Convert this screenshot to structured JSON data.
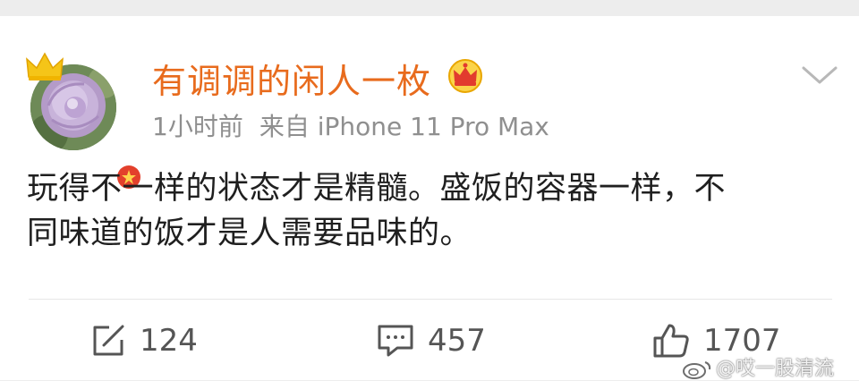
{
  "post": {
    "username": "有调调的闲人一枚",
    "time": "1小时前",
    "source": "来自 iPhone 11 Pro Max",
    "content_line1": "玩得不一样的状态才是精髓。盛饭的容器一样，不",
    "content_line2": "同味道的饭才是人需要品味的。"
  },
  "actions": {
    "repost_count": "124",
    "comment_count": "457",
    "like_count": "1707"
  },
  "watermark": {
    "text": "@哎一股清流"
  },
  "colors": {
    "username": "#e86b1d",
    "meta": "#8f8f8f",
    "body_text": "#1f1f1f",
    "verified_badge": "#e3402c",
    "crown": "#f5c518"
  },
  "icons": [
    "crown-icon",
    "verified-badge-icon",
    "vip-crown-icon",
    "chevron-down-icon",
    "repost-icon",
    "comment-icon",
    "like-icon",
    "weibo-logo-icon"
  ]
}
